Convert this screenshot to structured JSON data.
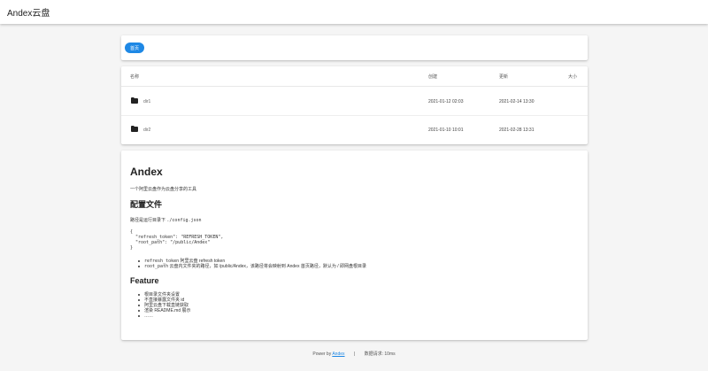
{
  "appbar": {
    "title": "Andex云盘"
  },
  "breadcrumb": {
    "home_label": "首页"
  },
  "table": {
    "headers": {
      "name": "名称",
      "created": "创建",
      "updated": "更新",
      "size": "大小"
    },
    "rows": [
      {
        "name": "dir1",
        "created": "2021-01-12 02:03",
        "updated": "2021-02-14 13:30",
        "icon": "folder-icon"
      },
      {
        "name": "dir2",
        "created": "2021-01-10 10:01",
        "updated": "2021-02-28 13:31",
        "icon": "folder-icon"
      }
    ]
  },
  "readme": {
    "title": "Andex",
    "intro": "一个阿里云盘作为云盘分享的工具",
    "config_heading": "配置文件",
    "config_path_prefix": "路径是运行目录下",
    "config_path_file": "./config.json",
    "config_code": "{\n  \"refresh_token\": \"REFRESH_TOKEN\",\n  \"root_path\": \"/public/Andex\"\n}",
    "config_items": [
      {
        "key": "refresh_token",
        "desc": "阿里云盘 refresh token"
      },
      {
        "key": "root_path",
        "desc": "云盘内文件夹的路径，如 /public/Andex，该路径将会映射到 Andex 首页路径，默认为 / 即网盘根目录"
      }
    ],
    "feature_heading": "Feature",
    "features": [
      "根目录文件夹设置",
      "不直接暴露文件夹 id",
      "阿里云盘下载直链获取",
      "渲染 README.md 展示",
      "……"
    ]
  },
  "footer": {
    "powered_prefix": "Power by",
    "powered_link": "Andex",
    "separator": "|",
    "timing": "数据请求: 10ms"
  },
  "colors": {
    "accent": "#1e88e5",
    "background": "#f5f5f5",
    "card": "#ffffff"
  }
}
